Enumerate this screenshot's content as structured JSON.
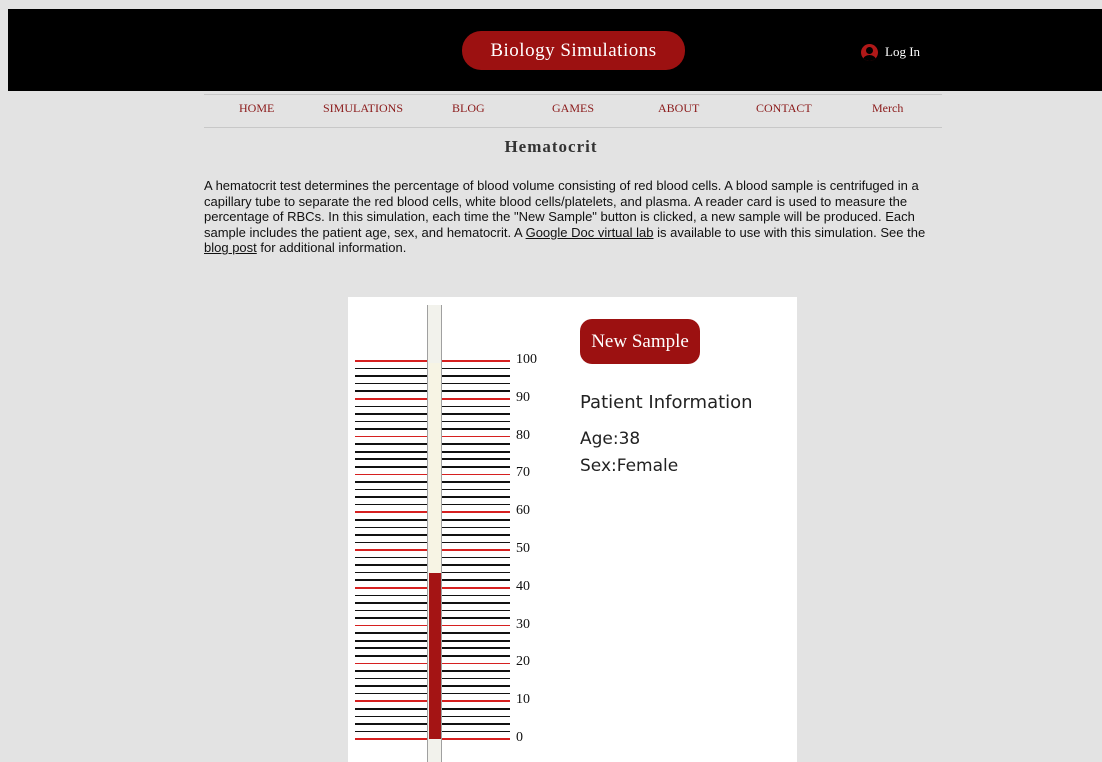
{
  "header": {
    "brand": "Biology Simulations",
    "login_label": "Log In",
    "login_icon": "user-avatar-icon"
  },
  "nav": [
    {
      "label": "HOME"
    },
    {
      "label": "SIMULATIONS"
    },
    {
      "label": "BLOG"
    },
    {
      "label": "GAMES"
    },
    {
      "label": "ABOUT"
    },
    {
      "label": "CONTACT"
    },
    {
      "label": "Merch"
    }
  ],
  "page": {
    "title": "Hematocrit",
    "intro_part1": "A hematocrit test determines the percentage of blood volume consisting of red blood cells. A blood sample is centrifuged in a capillary tube to separate the red blood cells, white blood cells/platelets, and plasma. A reader card is used to measure the percentage of RBCs. In this simulation, each time the \"New Sample\" button is clicked, a new sample will be produced. Each sample includes the patient age, sex, and hematocrit. A ",
    "intro_link1": "Google Doc virtual lab",
    "intro_part2": " is available to use with this simulation. See the ",
    "intro_link2": "blog post",
    "intro_part3": " for additional information."
  },
  "simulation": {
    "new_sample_label": "New Sample",
    "patient_info_title": "Patient Information",
    "age_label": "Age:",
    "age_value": "38",
    "sex_label": "Sex:",
    "sex_value": "Female",
    "hematocrit_percent": 44,
    "scale_labels": [
      "100",
      "90",
      "80",
      "70",
      "60",
      "50",
      "40",
      "30",
      "20",
      "10",
      "0"
    ]
  },
  "colors": {
    "brand": "#9c1111",
    "blood": "#a41414",
    "major_tick": "#d62020"
  }
}
